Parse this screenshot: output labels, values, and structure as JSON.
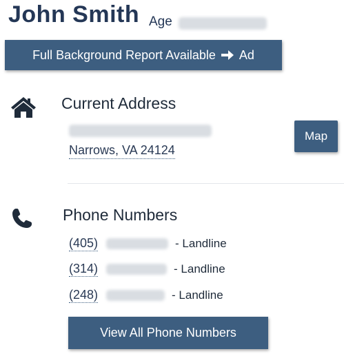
{
  "person": {
    "name": "John Smith",
    "age_label": "Age"
  },
  "background_report": {
    "label": "Full Background Report Available",
    "ad_label": "Ad",
    "icon": "arrow-right-icon"
  },
  "address": {
    "icon": "home-icon",
    "title": "Current Address",
    "city_line": "Narrows, VA 24124",
    "map_button": "Map"
  },
  "phones": {
    "icon": "phone-icon",
    "title": "Phone Numbers",
    "items": [
      {
        "area_code": "(405)",
        "type": "- Landline"
      },
      {
        "area_code": "(314)",
        "type": "- Landline"
      },
      {
        "area_code": "(248)",
        "type": "- Landline"
      }
    ],
    "view_all_button": "View All Phone Numbers"
  },
  "colors": {
    "primary": "#243756",
    "button": "#3d5e80",
    "blurred_placeholder": "#d9dde2"
  }
}
